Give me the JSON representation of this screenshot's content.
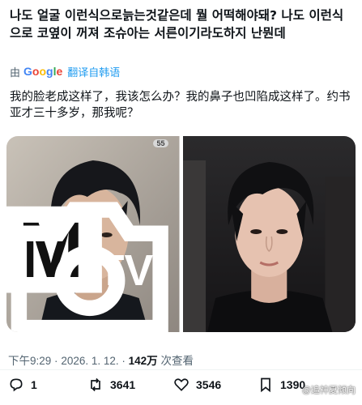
{
  "post": {
    "text": "나도 얼굴 이런식으로늙는것같은데 뭘 어떡해야돼? 나도 이런식으로 코옆이 꺼져 조슈아는 서른이기라도하지 난뭔데"
  },
  "translation": {
    "by_label": "由",
    "provider": "Google",
    "link_label": "翻译自韩语",
    "text": "我的脸老成这样了，我该怎么办？我的鼻子也凹陷成这样了。约书亚才三十多岁，那我呢？"
  },
  "media": {
    "left_badge": "55",
    "left_logo": "M",
    "left_logo_sub": "TV",
    "icons": [
      "mtv-logo-icon",
      "camera-icon"
    ]
  },
  "meta": {
    "time": "下午9:29",
    "date": "2026. 1. 12.",
    "views": "142万",
    "views_label": "次查看",
    "sep": "·"
  },
  "actions": {
    "replies": "1",
    "reposts": "3641",
    "likes": "3546",
    "bookmarks": "1390"
  },
  "watermark": "@追神夏倾向"
}
